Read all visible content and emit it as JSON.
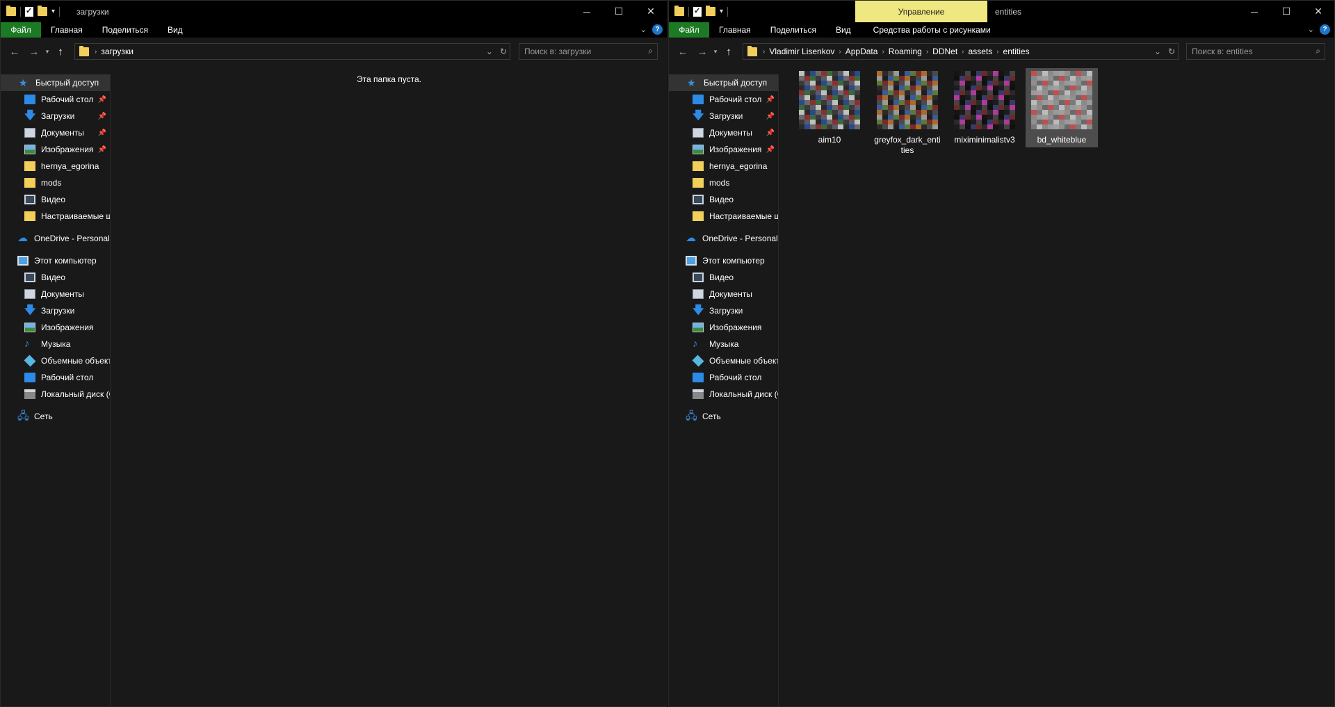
{
  "left": {
    "title": "загрузки",
    "menu": {
      "file": "Файл",
      "home": "Главная",
      "share": "Поделиться",
      "view": "Вид"
    },
    "address": {
      "crumbs": [
        "загрузки"
      ]
    },
    "search": {
      "placeholder": "Поиск в: загрузки"
    },
    "empty_message": "Эта папка пуста."
  },
  "right": {
    "title": "entities",
    "tools_tab": "Управление",
    "menu": {
      "file": "Файл",
      "home": "Главная",
      "share": "Поделиться",
      "view": "Вид",
      "picture_tools": "Средства работы с рисунками"
    },
    "address": {
      "crumbs": [
        "Vladimir Lisenkov",
        "AppData",
        "Roaming",
        "DDNet",
        "assets",
        "entities"
      ]
    },
    "search": {
      "placeholder": "Поиск в: entities"
    },
    "files": [
      {
        "name": "aim10",
        "selected": false
      },
      {
        "name": "greyfox_dark_entities",
        "selected": false
      },
      {
        "name": "miximinimalistv3",
        "selected": false
      },
      {
        "name": "bd_whiteblue",
        "selected": true
      }
    ]
  },
  "nav": {
    "quick_access": "Быстрый доступ",
    "quick_items": [
      {
        "label": "Рабочий стол",
        "icon": "desktop-icon",
        "pinned": true
      },
      {
        "label": "Загрузки",
        "icon": "downloads-icon",
        "pinned": true
      },
      {
        "label": "Документы",
        "icon": "documents-icon",
        "pinned": true
      },
      {
        "label": "Изображения",
        "icon": "pictures-icon",
        "pinned": true
      },
      {
        "label": "hernya_egorina",
        "icon": "folder-icon",
        "pinned": false
      },
      {
        "label": "mods",
        "icon": "folder-icon",
        "pinned": false
      },
      {
        "label": "Видео",
        "icon": "videos-icon",
        "pinned": false
      },
      {
        "label": "Настраиваемые ш",
        "icon": "folder-icon",
        "pinned": false
      }
    ],
    "onedrive": "OneDrive - Personal",
    "this_pc": "Этот компьютер",
    "pc_items": [
      {
        "label": "Видео",
        "icon": "videos-icon"
      },
      {
        "label": "Документы",
        "icon": "documents-icon"
      },
      {
        "label": "Загрузки",
        "icon": "downloads-icon"
      },
      {
        "label": "Изображения",
        "icon": "pictures-icon"
      },
      {
        "label": "Музыка",
        "icon": "music-icon"
      },
      {
        "label": "Объемные объект",
        "icon": "3d-objects-icon"
      },
      {
        "label": "Рабочий стол",
        "icon": "desktop-icon"
      },
      {
        "label": "Локальный диск (С",
        "icon": "local-disk-icon"
      }
    ],
    "network": "Сеть"
  },
  "colors": {
    "file_tab": "#1d7a24",
    "tools_tab": "#efe77f",
    "background": "#191919",
    "accent": "#2d8ae6"
  }
}
